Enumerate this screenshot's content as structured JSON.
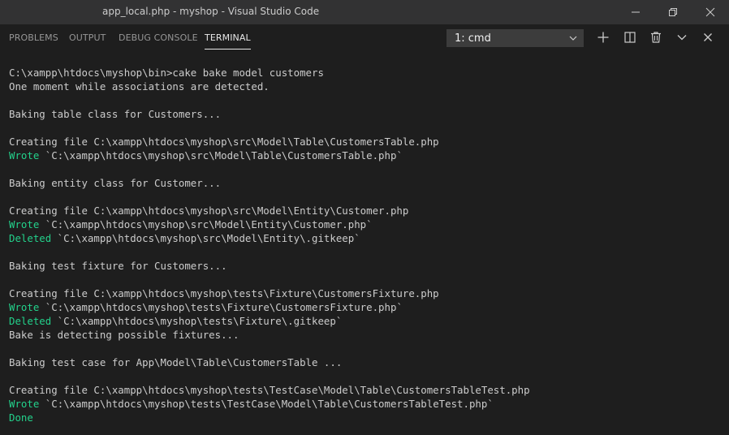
{
  "window": {
    "title": "app_local.php - myshop - Visual Studio Code"
  },
  "panel": {
    "tabs": [
      {
        "label": "PROBLEMS"
      },
      {
        "label": "OUTPUT"
      },
      {
        "label": "DEBUG CONSOLE"
      },
      {
        "label": "TERMINAL"
      }
    ],
    "active_tab": "TERMINAL",
    "terminal_select": {
      "value": "1: cmd"
    }
  },
  "icons": {
    "minimize": "minimize-icon",
    "restore": "restore-icon",
    "close_window": "close-window-icon",
    "new_terminal": "plus-icon",
    "split_terminal": "split-icon",
    "kill_terminal": "trash-icon",
    "maximize_panel": "chevron-down-icon",
    "close_panel": "close-icon"
  },
  "colors": {
    "success": "#23d18b",
    "text": "#cccccc",
    "background": "#1e1e1e"
  },
  "terminal": {
    "lines": [
      {
        "text": "C:\\xampp\\htdocs\\myshop\\bin>cake bake model customers"
      },
      {
        "text": "One moment while associations are detected."
      },
      {
        "text": ""
      },
      {
        "text": "Baking table class for Customers..."
      },
      {
        "text": ""
      },
      {
        "text": "Creating file C:\\xampp\\htdocs\\myshop\\src\\Model\\Table\\CustomersTable.php"
      },
      {
        "prefix": "Wrote",
        "text": " `C:\\xampp\\htdocs\\myshop\\src\\Model\\Table\\CustomersTable.php`"
      },
      {
        "text": ""
      },
      {
        "text": "Baking entity class for Customer..."
      },
      {
        "text": ""
      },
      {
        "text": "Creating file C:\\xampp\\htdocs\\myshop\\src\\Model\\Entity\\Customer.php"
      },
      {
        "prefix": "Wrote",
        "text": " `C:\\xampp\\htdocs\\myshop\\src\\Model\\Entity\\Customer.php`"
      },
      {
        "prefix": "Deleted",
        "text": " `C:\\xampp\\htdocs\\myshop\\src\\Model\\Entity\\.gitkeep`"
      },
      {
        "text": ""
      },
      {
        "text": "Baking test fixture for Customers..."
      },
      {
        "text": ""
      },
      {
        "text": "Creating file C:\\xampp\\htdocs\\myshop\\tests\\Fixture\\CustomersFixture.php"
      },
      {
        "prefix": "Wrote",
        "text": " `C:\\xampp\\htdocs\\myshop\\tests\\Fixture\\CustomersFixture.php`"
      },
      {
        "prefix": "Deleted",
        "text": " `C:\\xampp\\htdocs\\myshop\\tests\\Fixture\\.gitkeep`"
      },
      {
        "text": "Bake is detecting possible fixtures..."
      },
      {
        "text": ""
      },
      {
        "text": "Baking test case for App\\Model\\Table\\CustomersTable ..."
      },
      {
        "text": ""
      },
      {
        "text": "Creating file C:\\xampp\\htdocs\\myshop\\tests\\TestCase\\Model\\Table\\CustomersTableTest.php"
      },
      {
        "prefix": "Wrote",
        "text": " `C:\\xampp\\htdocs\\myshop\\tests\\TestCase\\Model\\Table\\CustomersTableTest.php`"
      },
      {
        "prefix": "Done",
        "text": ""
      }
    ]
  }
}
